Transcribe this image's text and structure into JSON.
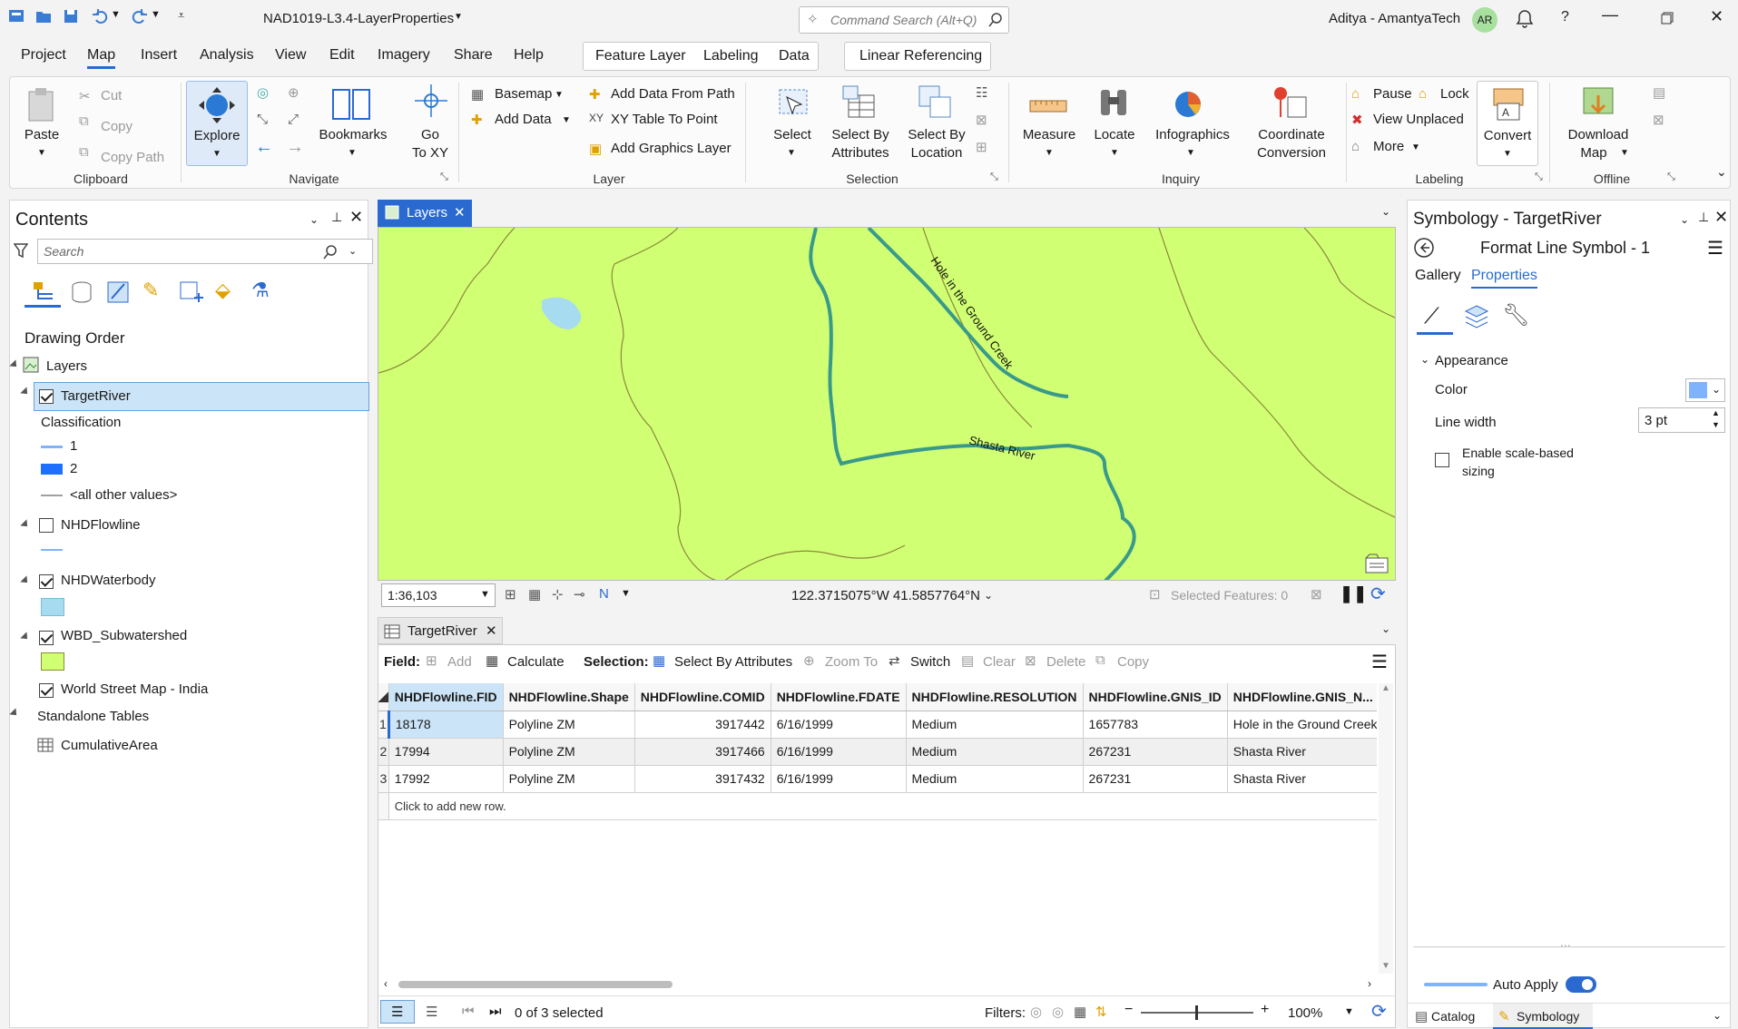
{
  "titlebar": {
    "project_title": "NAD1019-L3.4-LayerProperties",
    "command_search_placeholder": "Command Search (Alt+Q)",
    "user_name": "Aditya - AmantyaTech",
    "user_initials": "AR"
  },
  "menu": {
    "tabs": [
      "Project",
      "Map",
      "Insert",
      "Analysis",
      "View",
      "Edit",
      "Imagery",
      "Share",
      "Help"
    ],
    "active_tab": "Map",
    "context_tabs": [
      "Feature Layer",
      "Labeling",
      "Data"
    ],
    "linear_referencing": "Linear Referencing"
  },
  "ribbon": {
    "clipboard": {
      "label": "Clipboard",
      "paste": "Paste",
      "cut": "Cut",
      "copy": "Copy",
      "copy_path": "Copy Path"
    },
    "navigate": {
      "label": "Navigate",
      "explore": "Explore",
      "bookmarks": "Bookmarks",
      "go_to_xy_1": "Go",
      "go_to_xy_2": "To XY"
    },
    "layer": {
      "label": "Layer",
      "basemap": "Basemap",
      "add_data": "Add Data",
      "add_data_from_path": "Add Data From Path",
      "xy_table_to_point": "XY Table To Point",
      "add_graphics_layer": "Add Graphics Layer"
    },
    "selection": {
      "label": "Selection",
      "select": "Select",
      "select_by_attributes_1": "Select By",
      "select_by_attributes_2": "Attributes",
      "select_by_location_1": "Select By",
      "select_by_location_2": "Location"
    },
    "inquiry": {
      "label": "Inquiry",
      "measure": "Measure",
      "locate": "Locate",
      "infographics": "Infographics",
      "coord_conv_1": "Coordinate",
      "coord_conv_2": "Conversion"
    },
    "labeling": {
      "label": "Labeling",
      "pause": "Pause",
      "lock": "Lock",
      "view_unplaced": "View Unplaced",
      "more": "More",
      "convert": "Convert"
    },
    "offline": {
      "label": "Offline",
      "download_map_1": "Download",
      "download_map_2": "Map"
    }
  },
  "contents": {
    "title": "Contents",
    "search_placeholder": "Search",
    "drawing_order": "Drawing Order",
    "map_name": "Layers",
    "layers": [
      {
        "name": "TargetRiver",
        "checked": true
      },
      {
        "name": "NHDFlowline",
        "checked": false
      },
      {
        "name": "NHDWaterbody",
        "checked": true
      },
      {
        "name": "WBD_Subwatershed",
        "checked": true
      },
      {
        "name": "World Street Map - India",
        "checked": true
      }
    ],
    "classification": "Classification",
    "class_values": [
      "1",
      "2",
      "<all other values>"
    ],
    "standalone_tables": "Standalone Tables",
    "table_name": "CumulativeArea",
    "colors": {
      "class1": "#7fb3ff",
      "class2": "#1f6fff",
      "other": "#a0a0a0",
      "flowline": "#7fb3ff",
      "waterbody": "#a6dbf0",
      "subwatershed": "#d1ff73"
    }
  },
  "map": {
    "tab_label": "Layers",
    "labels": {
      "creek": "Hole in the Ground Creek",
      "river": "Shasta River"
    },
    "scale": "1:36,103",
    "coordinates": "122.3715075°W 41.5857764°N",
    "selected_features": "Selected Features: 0",
    "colors": {
      "background": "#d1ff73",
      "river": "#3a9a8a",
      "boundary": "#8a8a3a",
      "water": "#a6dbf0"
    }
  },
  "attribute_table": {
    "tab_label": "TargetRiver",
    "field_label": "Field:",
    "add": "Add",
    "calculate": "Calculate",
    "selection_label": "Selection:",
    "select_by_attributes": "Select By Attributes",
    "zoom_to": "Zoom To",
    "switch": "Switch",
    "clear": "Clear",
    "delete": "Delete",
    "copy": "Copy",
    "columns": [
      "NHDFlowline.FID",
      "NHDFlowline.Shape",
      "NHDFlowline.COMID",
      "NHDFlowline.FDATE",
      "NHDFlowline.RESOLUTION",
      "NHDFlowline.GNIS_ID",
      "NHDFlowline.GNIS_N..."
    ],
    "rows": [
      [
        "1",
        "18178",
        "Polyline ZM",
        "3917442",
        "6/16/1999",
        "Medium",
        "1657783",
        "Hole in the Ground Creek"
      ],
      [
        "2",
        "17994",
        "Polyline ZM",
        "3917466",
        "6/16/1999",
        "Medium",
        "267231",
        "Shasta River"
      ],
      [
        "3",
        "17992",
        "Polyline ZM",
        "3917432",
        "6/16/1999",
        "Medium",
        "267231",
        "Shasta River"
      ]
    ],
    "add_row_hint": "Click to add new row.",
    "selected_count": "0 of 3 selected",
    "filters_label": "Filters:",
    "zoom_level": "100%"
  },
  "symbology": {
    "title": "Symbology - TargetRiver",
    "subtitle": "Format Line Symbol - 1",
    "tabs": [
      "Gallery",
      "Properties"
    ],
    "active_tab": "Properties",
    "appearance": "Appearance",
    "color_label": "Color",
    "color_value": "#7fb3ff",
    "line_width_label": "Line width",
    "line_width_value": "3 pt",
    "scale_sizing_1": "Enable scale-based",
    "scale_sizing_2": "sizing",
    "auto_apply": "Auto Apply",
    "bottom_tabs": [
      "Catalog",
      "Symbology"
    ]
  }
}
